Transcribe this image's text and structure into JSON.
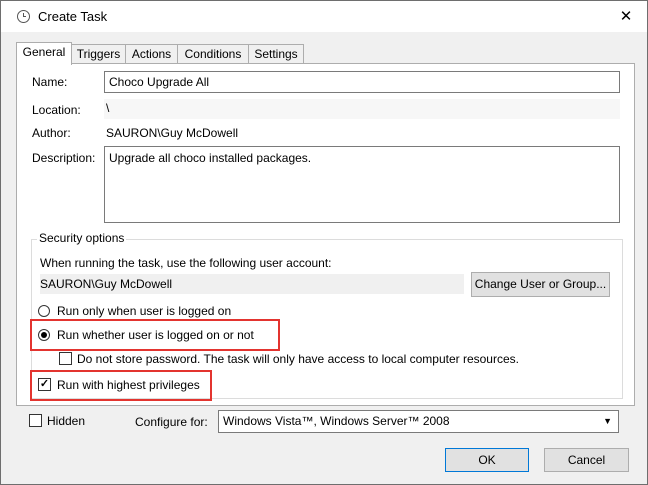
{
  "window": {
    "title": "Create Task",
    "close_glyph": "✕"
  },
  "tabs": [
    {
      "label": "General",
      "active": true
    },
    {
      "label": "Triggers",
      "active": false
    },
    {
      "label": "Actions",
      "active": false
    },
    {
      "label": "Conditions",
      "active": false
    },
    {
      "label": "Settings",
      "active": false
    }
  ],
  "general": {
    "name_label": "Name:",
    "name_value": "Choco Upgrade All",
    "location_label": "Location:",
    "location_value": "\\",
    "author_label": "Author:",
    "author_value": "SAURON\\Guy McDowell",
    "description_label": "Description:",
    "description_value": "Upgrade all choco installed packages."
  },
  "security": {
    "group_title": "Security options",
    "account_prompt": "When running the task, use the following user account:",
    "user_account": "SAURON\\Guy McDowell",
    "change_user_button": "Change User or Group...",
    "radio_logged_on": "Run only when user is logged on",
    "radio_whether": "Run whether user is logged on or not",
    "selected_radio": "whether",
    "do_not_store_password": "Do not store password.  The task will only have access to local computer resources.",
    "do_not_store_checked": false,
    "highest_privileges": "Run with highest privileges",
    "highest_privileges_checked": true
  },
  "footer": {
    "hidden_label": "Hidden",
    "hidden_checked": false,
    "configure_label": "Configure for:",
    "configure_value": "Windows Vista™, Windows Server™ 2008",
    "ok_button": "OK",
    "cancel_button": "Cancel"
  },
  "colors": {
    "highlight": "#e3342f",
    "dialog_bg": "#f0f0f0"
  },
  "icons": {
    "title": "clock-icon",
    "close": "close-icon",
    "dropdown": "chevron-down-icon",
    "checkmark": "checkmark-icon"
  }
}
